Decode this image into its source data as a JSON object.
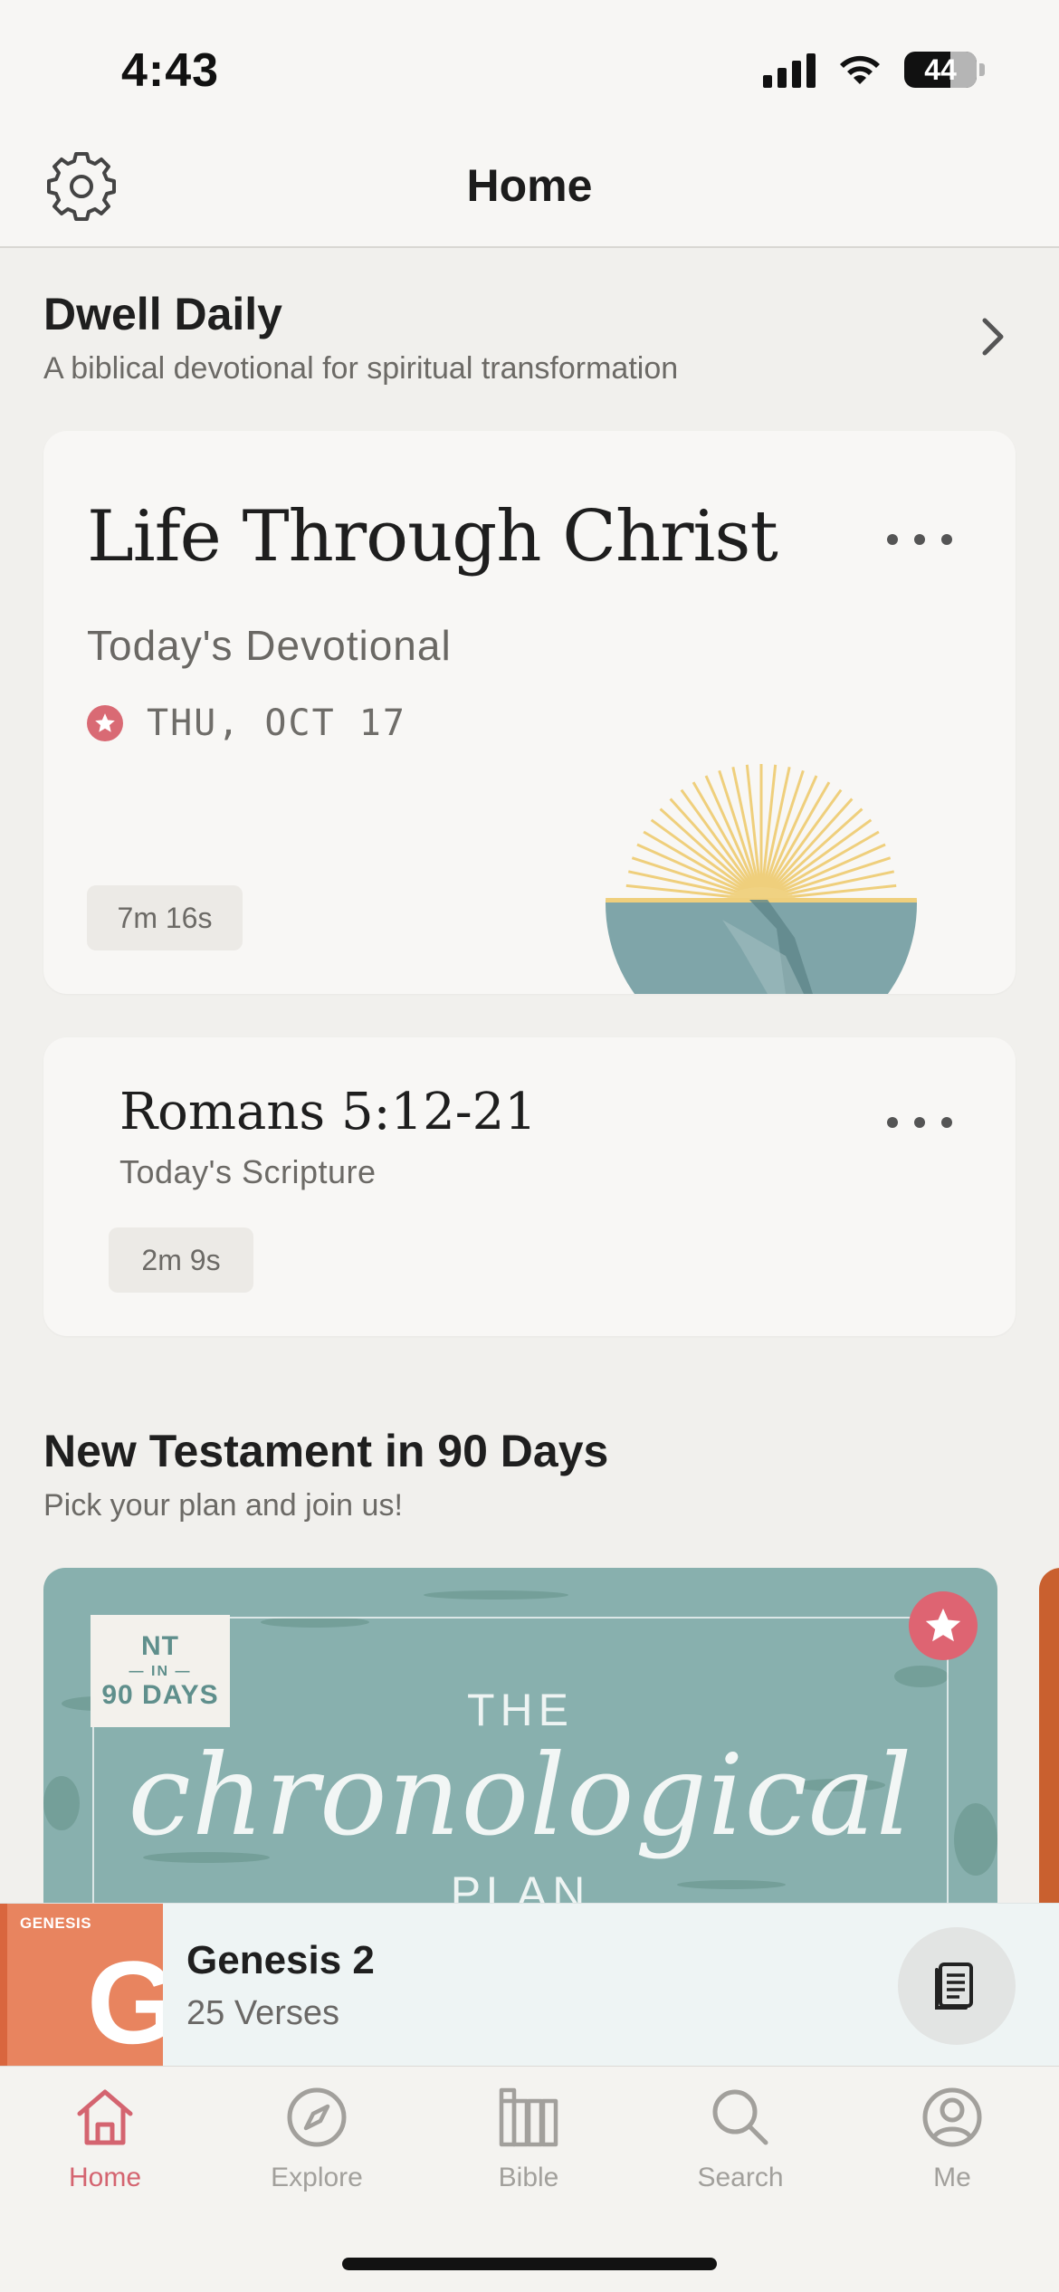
{
  "status_bar": {
    "time": "4:43",
    "battery": "44"
  },
  "header": {
    "title": "Home",
    "settings_icon": "gear-icon"
  },
  "dwell_daily": {
    "title": "Dwell Daily",
    "subtitle": "A biblical devotional for spiritual transformation"
  },
  "devotional": {
    "title": "Life Through Christ",
    "subtitle": "Today's Devotional",
    "date": "THU, OCT 17",
    "duration": "7m 16s",
    "accent": "#d96a74"
  },
  "scripture": {
    "title": "Romans 5:12-21",
    "subtitle": "Today's Scripture",
    "duration": "2m 9s"
  },
  "plans_section": {
    "title": "New Testament in 90 Days",
    "subtitle": "Pick your plan and join us!",
    "card": {
      "badge_line1": "NT",
      "badge_line2": "— IN —",
      "badge_line3": "90 DAYS",
      "the": "THE",
      "name": "chronological",
      "plan": "PLAN"
    }
  },
  "mini_player": {
    "cover_label": "GENESIS",
    "cover_letter": "G",
    "title": "Genesis 2",
    "subtitle": "25 Verses"
  },
  "tabs": [
    {
      "label": "Home",
      "icon": "home-icon",
      "active": true
    },
    {
      "label": "Explore",
      "icon": "compass-icon",
      "active": false
    },
    {
      "label": "Bible",
      "icon": "books-icon",
      "active": false
    },
    {
      "label": "Search",
      "icon": "search-icon",
      "active": false
    },
    {
      "label": "Me",
      "icon": "profile-icon",
      "active": false
    }
  ],
  "colors": {
    "accent": "#d46470",
    "background": "#f1f0ed",
    "plan_teal": "#88b0ae"
  }
}
